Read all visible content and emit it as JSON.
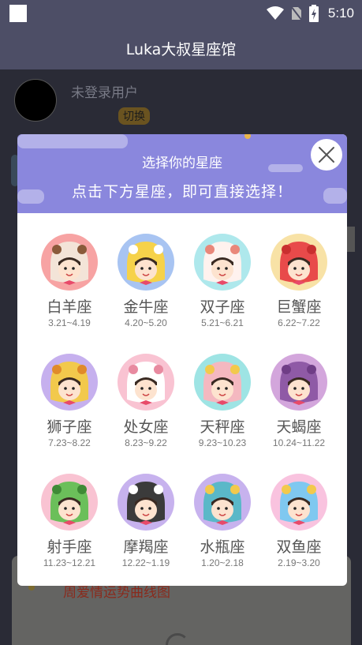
{
  "status_bar": {
    "time": "5:10"
  },
  "app_bar": {
    "title": "Luka大叔星座馆"
  },
  "user": {
    "name": "未登录用户",
    "switch_label": "切换"
  },
  "background_card": {
    "text": "周爱情运势曲线图"
  },
  "dialog": {
    "title": "选择你的星座",
    "subtitle": "点击下方星座，即可直接选择！",
    "close_icon": "close-icon"
  },
  "signs": [
    {
      "name": "白羊座",
      "range": "3.21~4.19",
      "bg": "#f7a3a3",
      "hat": "#f3e4d8",
      "accent": "#8a5a3a"
    },
    {
      "name": "金牛座",
      "range": "4.20~5.20",
      "bg": "#a8c4f2",
      "hat": "#f6d24a",
      "accent": "#ffffff"
    },
    {
      "name": "双子座",
      "range": "5.21~6.21",
      "bg": "#aee8ec",
      "hat": "#fff2ee",
      "accent": "#e9877a"
    },
    {
      "name": "巨蟹座",
      "range": "6.22~7.22",
      "bg": "#f8e2a6",
      "hat": "#e84a4a",
      "accent": "#c92f2f"
    },
    {
      "name": "狮子座",
      "range": "7.23~8.22",
      "bg": "#c6b0ee",
      "hat": "#f2c94c",
      "accent": "#e08a2a"
    },
    {
      "name": "处女座",
      "range": "8.23~9.22",
      "bg": "#f9c3d2",
      "hat": "#ffffff",
      "accent": "#e88aa0"
    },
    {
      "name": "天秤座",
      "range": "9.23~10.23",
      "bg": "#9ee4e4",
      "hat": "#f4b8c0",
      "accent": "#f2c94c"
    },
    {
      "name": "天蝎座",
      "range": "10.24~11.22",
      "bg": "#d3a6dc",
      "hat": "#8f5aa6",
      "accent": "#6f3d86"
    },
    {
      "name": "射手座",
      "range": "11.23~12.21",
      "bg": "#f9c3d2",
      "hat": "#6bbf5a",
      "accent": "#3f8a36"
    },
    {
      "name": "摩羯座",
      "range": "12.22~1.19",
      "bg": "#c7b2ee",
      "hat": "#3b3b3b",
      "accent": "#ffffff"
    },
    {
      "name": "水瓶座",
      "range": "1.20~2.18",
      "bg": "#c7b2ee",
      "hat": "#5ab8c8",
      "accent": "#f2c94c"
    },
    {
      "name": "双鱼座",
      "range": "2.19~3.20",
      "bg": "#f9c3df",
      "hat": "#7fc8f0",
      "accent": "#f2c94c"
    }
  ]
}
